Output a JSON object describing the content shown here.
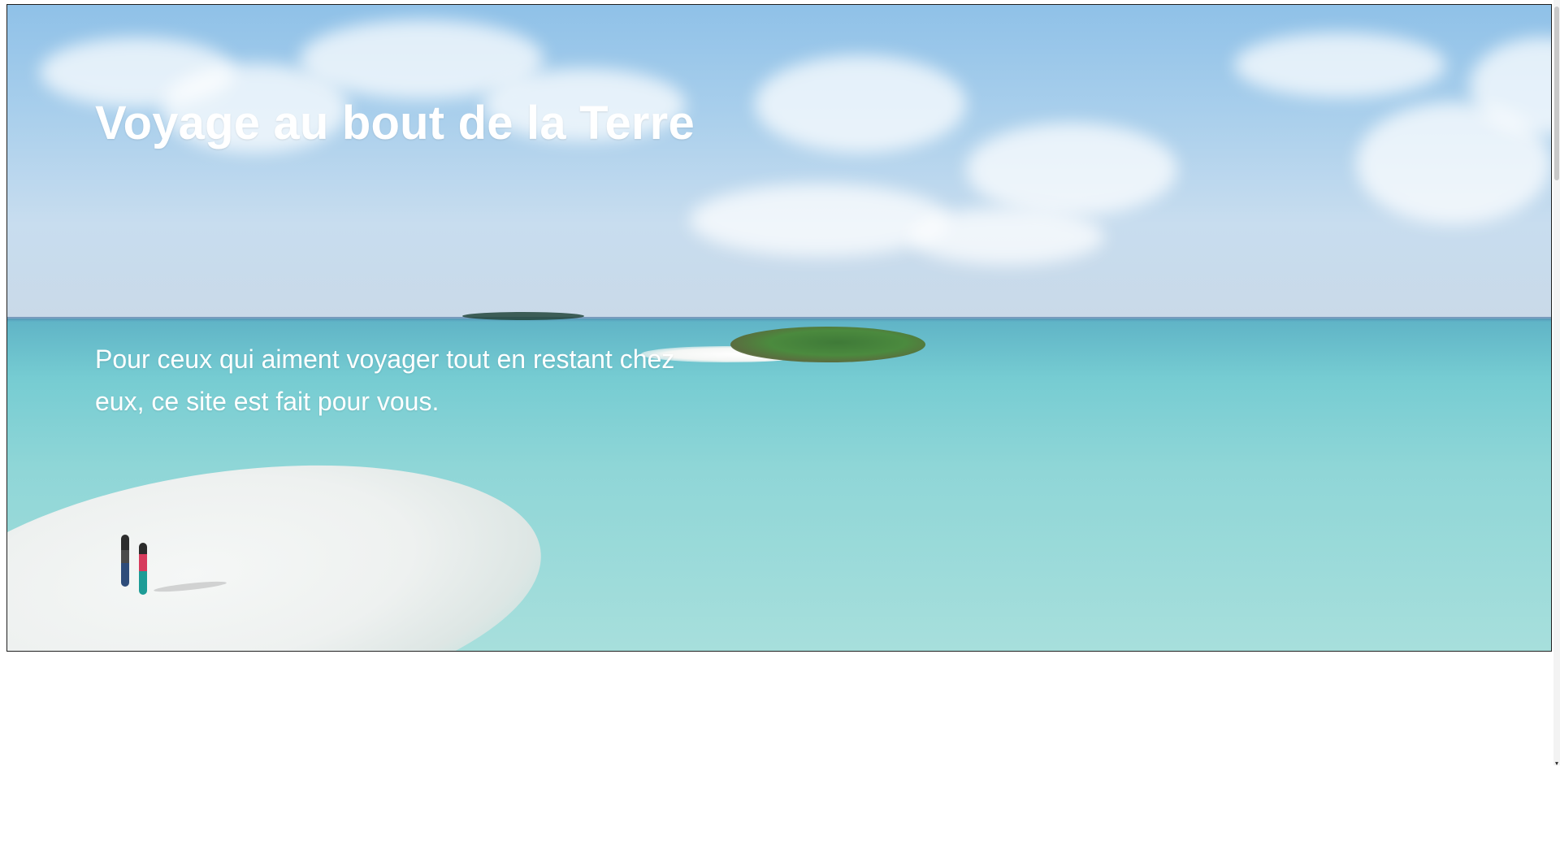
{
  "hero": {
    "title": "Voyage au bout de la Terre",
    "subtitle": "Pour ceux qui aiment voyager tout en restant chez eux, ce site est fait pour vous."
  },
  "scrollbar": {
    "arrow_icon": "chevron-down-icon",
    "arrow_glyph": "▾"
  },
  "colors": {
    "text": "#ffffff",
    "page_background": "#ffffff"
  }
}
